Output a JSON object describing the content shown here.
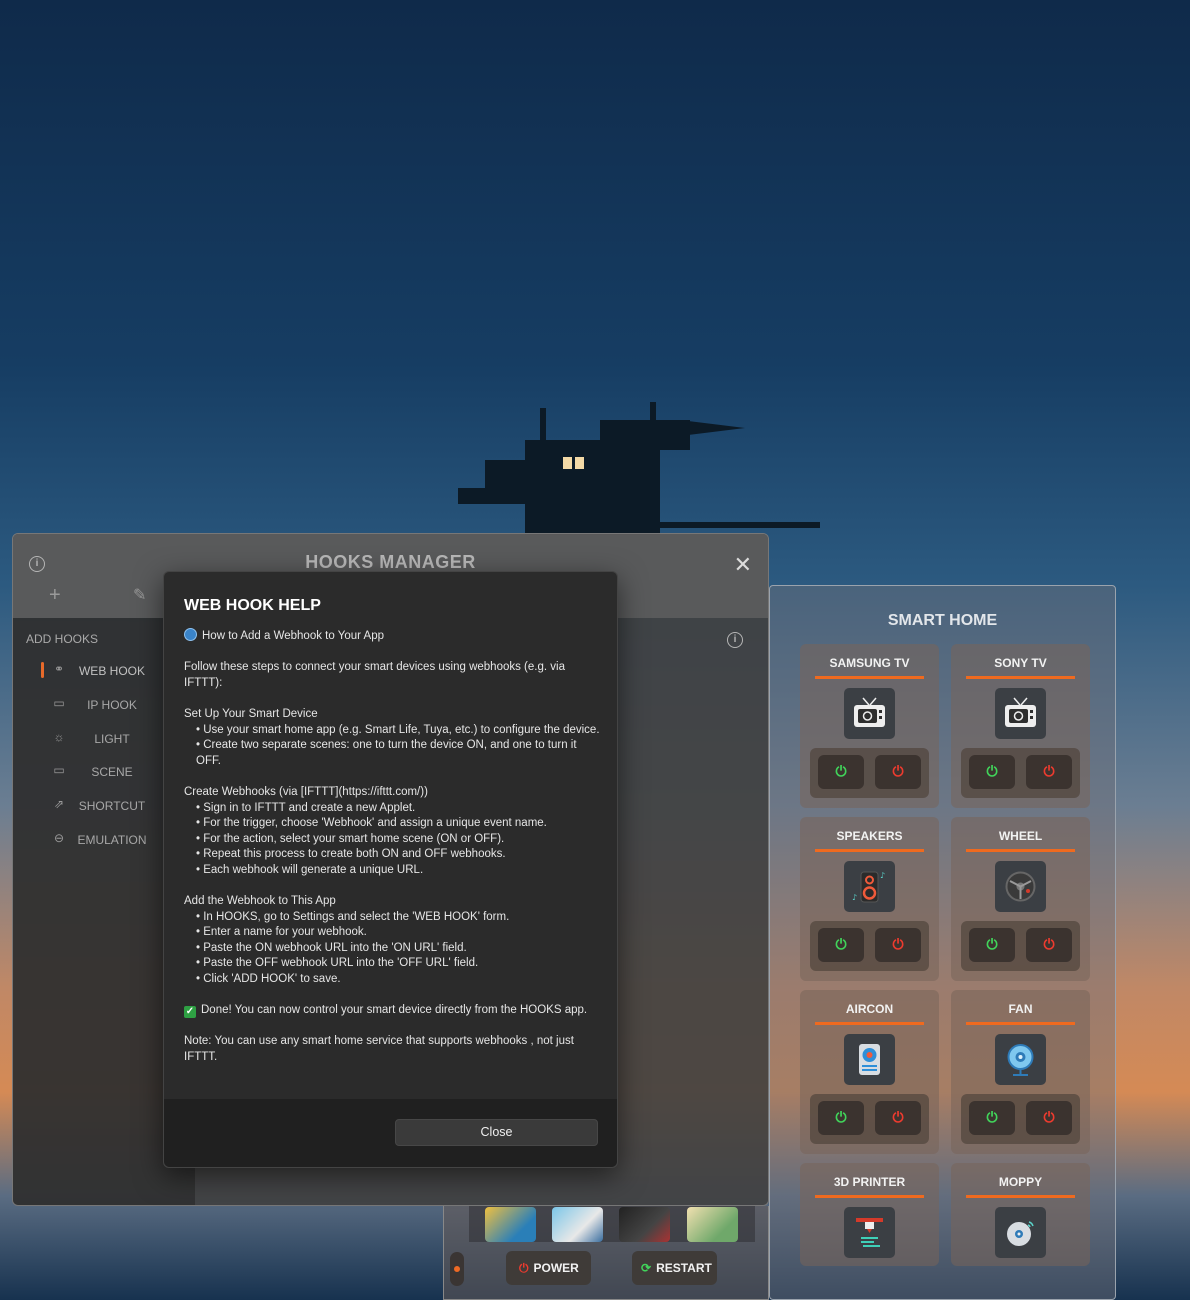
{
  "hooks_manager": {
    "title": "HOOKS MANAGER",
    "sidebar_heading": "ADD HOOKS",
    "items": [
      {
        "label": "WEB HOOK",
        "icon": "link-icon",
        "active": true
      },
      {
        "label": "IP HOOK",
        "icon": "monitor-icon",
        "active": false
      },
      {
        "label": "LIGHT",
        "icon": "sun-icon",
        "active": false
      },
      {
        "label": "SCENE",
        "icon": "video-camera-icon",
        "active": false
      },
      {
        "label": "SHORTCUT",
        "icon": "external-link-icon",
        "active": false
      },
      {
        "label": "EMULATION",
        "icon": "gamepad-icon",
        "active": false
      }
    ]
  },
  "help_dialog": {
    "title": "WEB HOOK HELP",
    "intro_heading": "How to Add a Webhook to Your App",
    "intro": "Follow these steps to connect your smart devices using webhooks (e.g. via IFTTT):",
    "section1_heading": "Set Up Your Smart Device",
    "section1_items": [
      "• Use your smart home app (e.g. Smart Life, Tuya, etc.) to configure the device.",
      "• Create two separate scenes: one to turn the device ON, and one to turn it OFF."
    ],
    "section2_heading": "Create Webhooks (via [IFTTT](https://ifttt.com/))",
    "section2_items": [
      "• Sign in to IFTTT and create a new Applet.",
      "• For the trigger, choose 'Webhook' and assign a unique event name.",
      "• For the action, select your smart home scene (ON or OFF).",
      "• Repeat this process to create both ON and OFF webhooks.",
      "• Each webhook will generate a unique URL."
    ],
    "section3_heading": "Add the Webhook to This App",
    "section3_items": [
      "• In HOOKS, go to Settings and select the 'WEB HOOK' form.",
      "• Enter a name for your webhook.",
      "• Paste the ON webhook URL into the 'ON URL' field.",
      "• Paste the OFF webhook URL into the 'OFF URL' field.",
      "• Click 'ADD HOOK' to save."
    ],
    "done_text": "Done! You can now control your smart device directly from the HOOKS app.",
    "note": "Note: You can use any smart home service that supports webhooks ,  not just IFTTT.",
    "close_label": "Close"
  },
  "smart_home": {
    "title": "SMART HOME",
    "devices": [
      {
        "name": "SAMSUNG TV",
        "icon": "tv-icon"
      },
      {
        "name": "SONY TV",
        "icon": "tv-icon"
      },
      {
        "name": "SPEAKERS",
        "icon": "speaker-icon"
      },
      {
        "name": "WHEEL",
        "icon": "steering-wheel-icon"
      },
      {
        "name": "AIRCON",
        "icon": "aircon-icon"
      },
      {
        "name": "FAN",
        "icon": "fan-icon"
      },
      {
        "name": "3D PRINTER",
        "icon": "3d-printer-icon"
      },
      {
        "name": "MOPPY",
        "icon": "floppy-drive-icon"
      }
    ],
    "on_symbol": "⏻",
    "off_symbol": "⏻"
  },
  "launcher": {
    "power_label": "POWER",
    "restart_label": "RESTART",
    "power_symbol": "⏻",
    "restart_symbol": "⟳"
  },
  "colors": {
    "accent": "#ef6a1f",
    "on_green": "#41d35a",
    "off_red": "#ec3b2f"
  }
}
